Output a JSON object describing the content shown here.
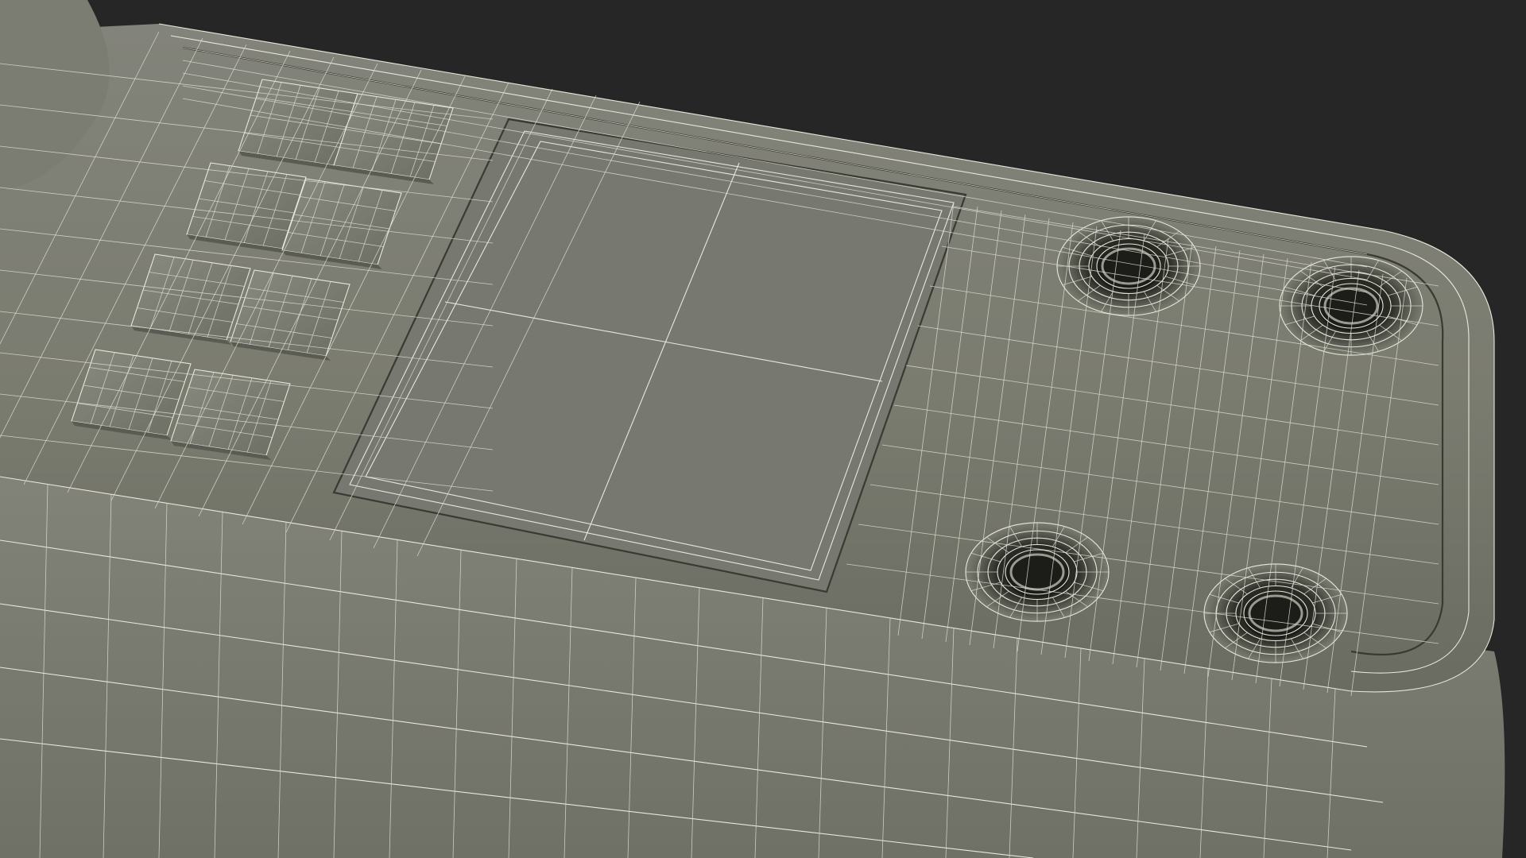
{
  "scene": {
    "background_color": "#262626",
    "surface_color": "#7b7c70",
    "surface_shadow": "#5f6057",
    "surface_highlight": "#8a8b80",
    "wire_color": "#e8e8dc",
    "hole_inner_color": "#1c1c18",
    "render_mode": "wireframe-on-shaded"
  },
  "model": {
    "keypad_keys": 8,
    "screw_holes": 4,
    "display_grid": "2x2"
  }
}
